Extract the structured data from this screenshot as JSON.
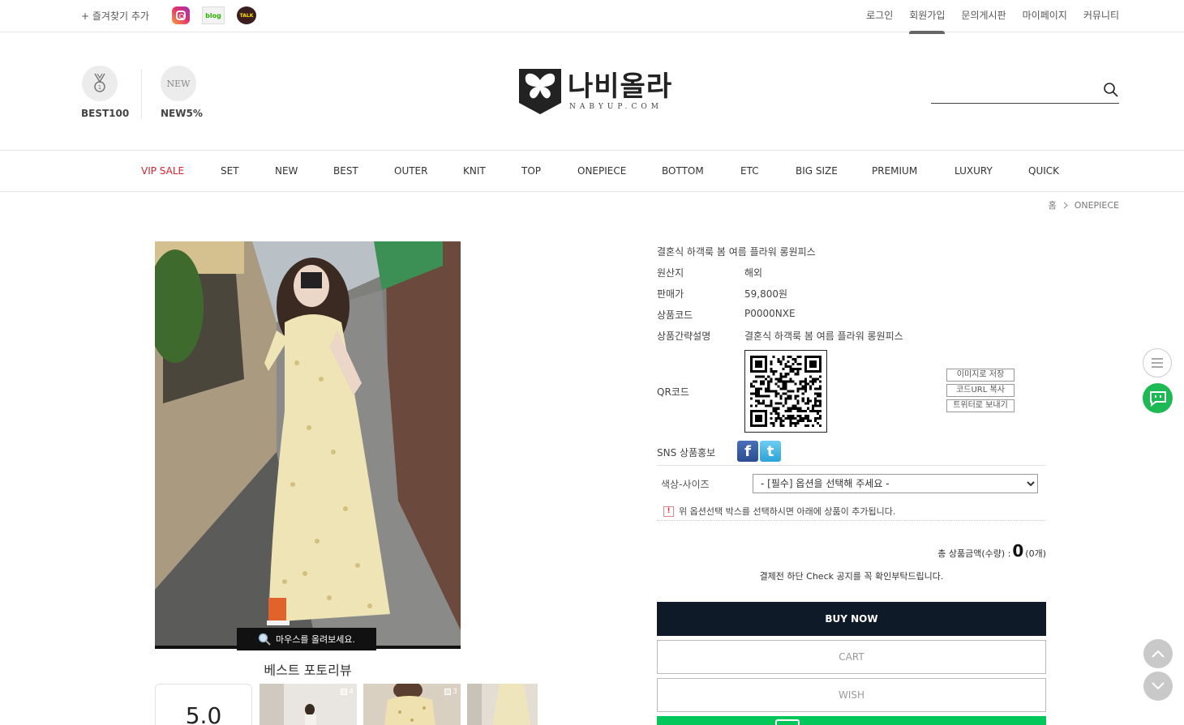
{
  "topbar": {
    "favorite": "+ 즐겨찾기 추가",
    "sns": {
      "instagram": "instagram-icon",
      "blog": "blog",
      "talk": "TALK"
    },
    "links": [
      "로그인",
      "회원가입",
      "문의게시판",
      "마이페이지",
      "커뮤니티"
    ],
    "active_link": "회원가입"
  },
  "header": {
    "best_label": "BEST100",
    "new_circle": "NEW",
    "new_label": "NEW5%",
    "logo_kr": "나비올라",
    "logo_en": "NABYUP.COM",
    "search_placeholder": ""
  },
  "nav": [
    "VIP SALE",
    "SET",
    "NEW",
    "BEST",
    "OUTER",
    "KNIT",
    "TOP",
    "ONEPIECE",
    "BOTTOM",
    "ETC",
    "BIG SIZE",
    "PREMIUM",
    "LUXURY",
    "QUICK"
  ],
  "breadcrumb": {
    "home": "홈",
    "current": "ONEPIECE"
  },
  "gallery": {
    "zoom_tip": "마우스를 올려보세요.",
    "review_title": "베스트 포토리뷰",
    "score": "5.0",
    "thumbs": [
      {
        "count": "4"
      },
      {
        "count": "3"
      },
      {
        "count": ""
      }
    ]
  },
  "product": {
    "name": "결혼식 하객룩 봄 여름 플라워 롱원피스",
    "rows": [
      {
        "label": "원산지",
        "value": "해외"
      },
      {
        "label": "판매가",
        "value": "59,800원"
      },
      {
        "label": "상품코드",
        "value": "P0000NXE"
      },
      {
        "label": "상품간략설명",
        "value": "결혼식 하객룩 봄 여름 플라워 롱원피스"
      }
    ],
    "qr_label": "QR코드",
    "qr_buttons": [
      "이미지로 저장",
      "코드URL 복사",
      "트위터로 보내기"
    ],
    "sns_label": "SNS 상품홍보",
    "option_label": "색상-사이즈",
    "option_selected": "- [필수] 옵션을 선택해 주세요 -",
    "notice": "위 옵션선택 박스를 선택하시면 아래에 상품이 추가됩니다.",
    "total_label": "총 상품금액(수량) :",
    "total_value": "0",
    "total_qty": "(0개)",
    "check_msg": "결제전 하단 Check 공지를 꼭 확인부탁드립니다.",
    "buy_now": "BUY NOW",
    "cart": "CART",
    "wish": "WISH"
  },
  "colors": {
    "accent_red": "#d9232f",
    "buy_bg": "#0e1a28",
    "npay_green": "#03c75a"
  }
}
